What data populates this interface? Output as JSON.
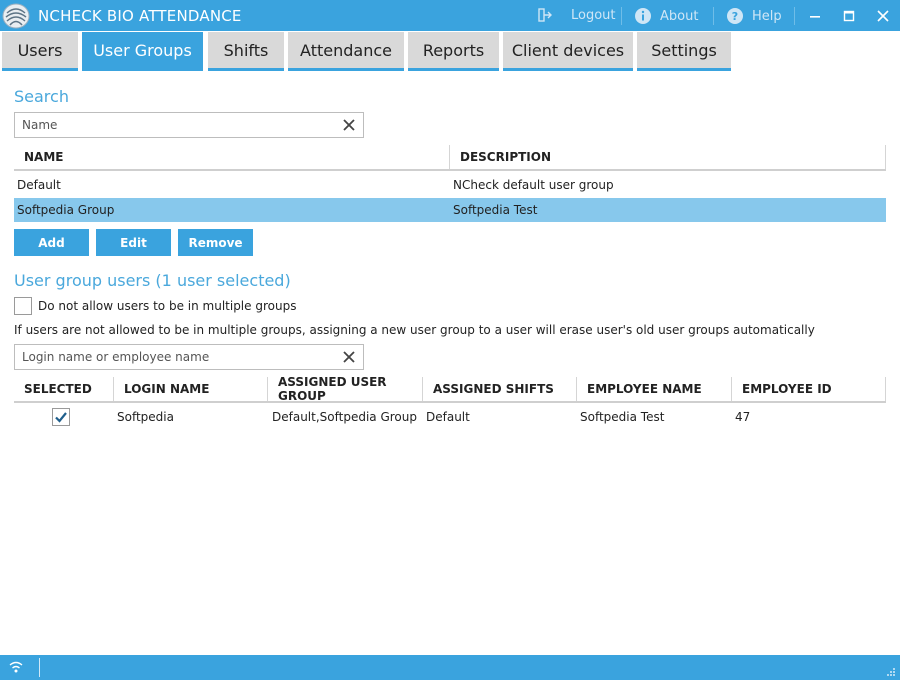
{
  "window": {
    "title": "NCHECK BIO ATTENDANCE",
    "logout_label": "Logout",
    "about_label": "About",
    "help_label": "Help"
  },
  "tabs": [
    {
      "label": "Users"
    },
    {
      "label": "User Groups"
    },
    {
      "label": "Shifts"
    },
    {
      "label": "Attendance"
    },
    {
      "label": "Reports"
    },
    {
      "label": "Client devices"
    },
    {
      "label": "Settings"
    }
  ],
  "active_tab": "User Groups",
  "search": {
    "title": "Search",
    "placeholder": "Name"
  },
  "groups_table": {
    "columns": [
      "NAME",
      "DESCRIPTION"
    ],
    "rows": [
      {
        "name": "Default",
        "description": "NCheck default user group",
        "selected": false
      },
      {
        "name": "Softpedia Group",
        "description": "Softpedia Test",
        "selected": true
      }
    ]
  },
  "actions": {
    "add_label": "Add",
    "edit_label": "Edit",
    "remove_label": "Remove"
  },
  "group_users": {
    "title": "User group users  (1 user selected)",
    "multiple_groups_label": "Do not allow users to be in multiple groups",
    "multiple_groups_checked": false,
    "info_text": "If users are not allowed to be in multiple groups, assigning a new user group to a user will erase user's old user groups automatically",
    "filter_placeholder": "Login name or employee name",
    "columns": [
      "SELECTED",
      "LOGIN NAME",
      "ASSIGNED USER GROUP",
      "ASSIGNED SHIFTS",
      "EMPLOYEE NAME",
      "EMPLOYEE ID"
    ],
    "rows": [
      {
        "selected": true,
        "login_name": "Softpedia",
        "assigned_user_group": "Default,Softpedia Group",
        "assigned_shifts": "Default",
        "employee_name": "Softpedia Test",
        "employee_id": "47"
      }
    ]
  },
  "colors": {
    "accent": "#3aa3de",
    "selected_row": "#87c8ec",
    "section_title": "#4aa8dc",
    "tab_inactive": "#d9d9d9"
  },
  "icons": {
    "app_logo": "fingerprint-logo-icon",
    "logout": "logout-icon",
    "about": "info-icon",
    "help": "help-icon",
    "clear": "close-icon",
    "status": "wifi-icon",
    "resize": "resize-grip-icon"
  }
}
